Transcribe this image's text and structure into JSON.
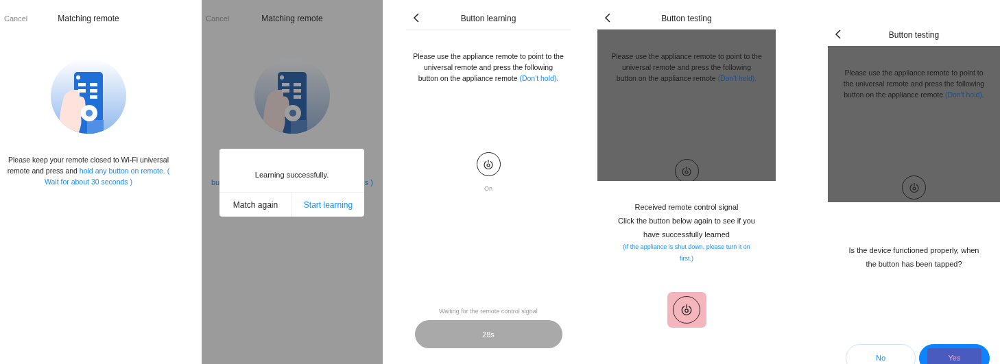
{
  "screens": [
    {
      "kind": "matching",
      "dimmed": false,
      "header": {
        "cancel": "Cancel",
        "title": "Matching remote"
      },
      "message": "Please keep your remote closed to Wi-Fi universal remote and press and",
      "message_highlight": "hold any button on remote. ( Wait for about 30 seconds )"
    },
    {
      "kind": "matching_dialog",
      "dimmed": true,
      "header": {
        "cancel": "Cancel",
        "title": "Matching remote"
      },
      "fragments": [
        "bu",
        "s )"
      ],
      "dialog": {
        "message": "Learning successfully.",
        "buttons": [
          {
            "label": "Match again",
            "kind": "default"
          },
          {
            "label": "Start learning",
            "kind": "primary"
          }
        ]
      }
    },
    {
      "kind": "learning",
      "header": {
        "title": "Button learning"
      },
      "instruction": "Please use the appliance remote to point to the universal remote and press the following button on the appliance remote",
      "instruction_highlight": "(Don't hold).",
      "key_label": "On",
      "status": "Waiting for the remote control signal",
      "countdown": "28s"
    },
    {
      "kind": "testing_received",
      "header": {
        "title": "Button testing"
      },
      "instruction": "Please use the appliance remote to point to the universal remote and press the following button on the appliance remote",
      "instruction_highlight": "(Don't hold).",
      "received": [
        "Received remote control signal",
        "Click the button below again to see if you have successfully learned"
      ],
      "note": "(If the appliance is shut down, please turn it on first.)"
    },
    {
      "kind": "testing_confirm",
      "header": {
        "title": "Button testing"
      },
      "instruction": "Please use the appliance remote to point to the universal remote and press the following button on the appliance remote",
      "instruction_highlight": "(Don't hold).",
      "question": "Is the device functioned properly, when the button has been tapped?",
      "buttons": [
        {
          "label": "No",
          "kind": "outline"
        },
        {
          "label": "Yes",
          "kind": "primary"
        }
      ]
    }
  ]
}
